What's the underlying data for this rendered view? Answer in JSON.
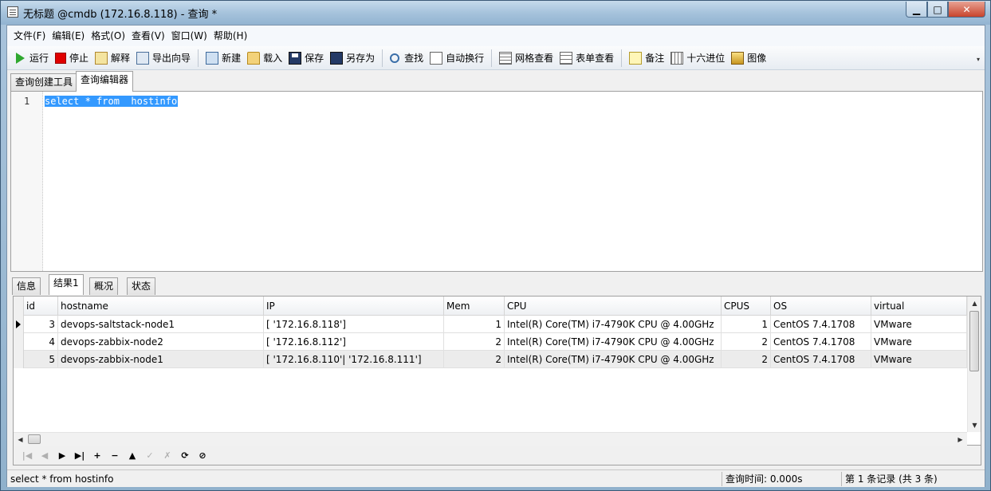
{
  "window": {
    "title": "无标题 @cmdb (172.16.8.118) - 查询 *",
    "min_glyph": "▁",
    "max_glyph": "□",
    "close_glyph": "✕"
  },
  "menu": [
    "文件(F)",
    "编辑(E)",
    "格式(O)",
    "查看(V)",
    "窗口(W)",
    "帮助(H)"
  ],
  "toolbar": {
    "run": "运行",
    "stop": "停止",
    "explain": "解释",
    "export_wizard": "导出向导",
    "new": "新建",
    "load": "载入",
    "save": "保存",
    "save_as": "另存为",
    "find": "查找",
    "word_wrap": "自动换行",
    "grid_view": "网格查看",
    "form_view": "表单查看",
    "memo": "备注",
    "hex": "十六进位",
    "image": "图像",
    "more_glyph": "▾"
  },
  "top_tabs": [
    "查询创建工具",
    "查询编辑器"
  ],
  "editor": {
    "line_number": "1",
    "sql": "select * from  hostinfo"
  },
  "result_tabs": [
    "信息",
    "结果1",
    "概况",
    "状态"
  ],
  "grid": {
    "columns": [
      "id",
      "hostname",
      "IP",
      "Mem",
      "CPU",
      "CPUS",
      "OS",
      "virtual"
    ],
    "rows": [
      [
        "3",
        "devops-saltstack-node1",
        "[ '172.16.8.118']",
        "1",
        "Intel(R) Core(TM) i7-4790K CPU @ 4.00GHz",
        "1",
        "CentOS 7.4.1708",
        "VMware"
      ],
      [
        "4",
        "devops-zabbix-node2",
        "[ '172.16.8.112']",
        "2",
        "Intel(R) Core(TM) i7-4790K CPU @ 4.00GHz",
        "2",
        "CentOS 7.4.1708",
        "VMware"
      ],
      [
        "5",
        "devops-zabbix-node1",
        "[ '172.16.8.110'| '172.16.8.111']",
        "2",
        "Intel(R) Core(TM) i7-4790K CPU @ 4.00GHz",
        "2",
        "CentOS 7.4.1708",
        "VMware"
      ]
    ],
    "scroll_up": "▲",
    "scroll_down": "▼",
    "scroll_left": "◀",
    "scroll_right": "▶"
  },
  "nav": {
    "first": "|◀",
    "prev": "◀",
    "next": "▶",
    "last": "▶|",
    "add": "+",
    "delete": "−",
    "post": "▲",
    "apply": "✓",
    "cancel": "✗",
    "refresh": "⟳",
    "stop": "⊘"
  },
  "status": {
    "sql": "select * from  hostinfo",
    "query_time": "查询时间: 0.000s",
    "record": "第 1 条记录 (共 3 条)"
  }
}
